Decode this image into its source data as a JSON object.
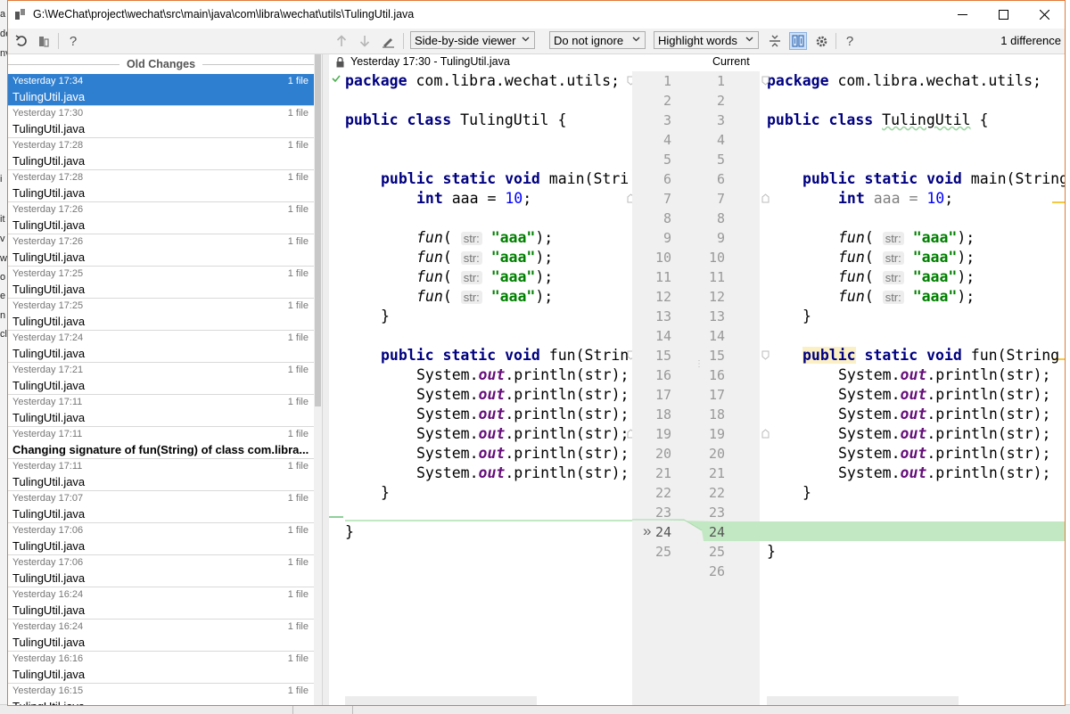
{
  "background_app": {
    "letters": [
      "a",
      "de",
      "nv",
      "i",
      "it",
      "v",
      "w",
      "o",
      "e",
      "n",
      "cl"
    ]
  },
  "window": {
    "title": "G:\\WeChat\\project\\wechat\\src\\main\\java\\com\\libra\\wechat\\utils\\TulingUtil.java",
    "minimize_icon": "minimize-icon",
    "maximize_icon": "maximize-icon",
    "close_icon": "close-icon"
  },
  "toolbar": {
    "viewer_mode": "Side-by-side viewer",
    "whitespace_mode": "Do not ignore",
    "highlight_mode": "Highlight words",
    "difference_count": "1 difference",
    "help_label": "?",
    "icons": [
      "revert-icon",
      "delete-icon",
      "help-icon",
      "prev-diff-icon",
      "next-diff-icon",
      "edit-icon",
      "collapse-icon",
      "sync-scroll-icon",
      "settings-icon",
      "help-icon"
    ]
  },
  "history": {
    "header": "Old Changes",
    "items": [
      {
        "date": "Yesterday 17:34",
        "count": "1 file",
        "name": "TulingUtil.java",
        "selected": true,
        "bold": false
      },
      {
        "date": "Yesterday 17:30",
        "count": "1 file",
        "name": "TulingUtil.java",
        "selected": false,
        "bold": false
      },
      {
        "date": "Yesterday 17:28",
        "count": "1 file",
        "name": "TulingUtil.java",
        "selected": false,
        "bold": false
      },
      {
        "date": "Yesterday 17:28",
        "count": "1 file",
        "name": "TulingUtil.java",
        "selected": false,
        "bold": false
      },
      {
        "date": "Yesterday 17:26",
        "count": "1 file",
        "name": "TulingUtil.java",
        "selected": false,
        "bold": false
      },
      {
        "date": "Yesterday 17:26",
        "count": "1 file",
        "name": "TulingUtil.java",
        "selected": false,
        "bold": false
      },
      {
        "date": "Yesterday 17:25",
        "count": "1 file",
        "name": "TulingUtil.java",
        "selected": false,
        "bold": false
      },
      {
        "date": "Yesterday 17:25",
        "count": "1 file",
        "name": "TulingUtil.java",
        "selected": false,
        "bold": false
      },
      {
        "date": "Yesterday 17:24",
        "count": "1 file",
        "name": "TulingUtil.java",
        "selected": false,
        "bold": false
      },
      {
        "date": "Yesterday 17:21",
        "count": "1 file",
        "name": "TulingUtil.java",
        "selected": false,
        "bold": false
      },
      {
        "date": "Yesterday 17:11",
        "count": "1 file",
        "name": "TulingUtil.java",
        "selected": false,
        "bold": false
      },
      {
        "date": "Yesterday 17:11",
        "count": "1 file",
        "name": "Changing signature of fun(String) of class com.libra...",
        "selected": false,
        "bold": true
      },
      {
        "date": "Yesterday 17:11",
        "count": "1 file",
        "name": "TulingUtil.java",
        "selected": false,
        "bold": false
      },
      {
        "date": "Yesterday 17:07",
        "count": "1 file",
        "name": "TulingUtil.java",
        "selected": false,
        "bold": false
      },
      {
        "date": "Yesterday 17:06",
        "count": "1 file",
        "name": "TulingUtil.java",
        "selected": false,
        "bold": false
      },
      {
        "date": "Yesterday 17:06",
        "count": "1 file",
        "name": "TulingUtil.java",
        "selected": false,
        "bold": false
      },
      {
        "date": "Yesterday 16:24",
        "count": "1 file",
        "name": "TulingUtil.java",
        "selected": false,
        "bold": false
      },
      {
        "date": "Yesterday 16:24",
        "count": "1 file",
        "name": "TulingUtil.java",
        "selected": false,
        "bold": false
      },
      {
        "date": "Yesterday 16:16",
        "count": "1 file",
        "name": "TulingUtil.java",
        "selected": false,
        "bold": false
      },
      {
        "date": "Yesterday 16:15",
        "count": "1 file",
        "name": "TulingUtil.java",
        "selected": false,
        "bold": false
      }
    ]
  },
  "diff": {
    "left_title": "Yesterday 17:30 - TulingUtil.java",
    "right_title": "Current",
    "left_line_numbers": [
      "1",
      "2",
      "3",
      "4",
      "5",
      "6",
      "7",
      "8",
      "9",
      "10",
      "11",
      "12",
      "13",
      "14",
      "15",
      "16",
      "17",
      "18",
      "19",
      "20",
      "21",
      "22",
      "23",
      "24",
      "25"
    ],
    "right_line_numbers": [
      "1",
      "2",
      "3",
      "4",
      "5",
      "6",
      "7",
      "8",
      "9",
      "10",
      "11",
      "12",
      "13",
      "14",
      "15",
      "16",
      "17",
      "18",
      "19",
      "20",
      "21",
      "22",
      "23",
      "24",
      "25",
      "26"
    ],
    "inlay_hint": "str:",
    "changed_marker": "»",
    "status_color_added": "#c2e8c3",
    "tokens": {
      "package": "package",
      "pkg_name": "com.libra.wechat.utils;",
      "public": "public",
      "class": "class",
      "class_name": "TulingUtil",
      "brace_open": "{",
      "brace_close": "}",
      "static": "static",
      "void": "void",
      "main_left": "main(Stri",
      "main_right": "main(String",
      "int": "int",
      "var_decl": "aaa = ",
      "ten": "10",
      "semi": ";",
      "fun": "fun",
      "paren_open": "( ",
      "aaa_str": "\"aaa\"",
      "call_end": ");",
      "fun_left": "fun(Strin",
      "fun_right": "fun(String",
      "system": "System.",
      "out": "out",
      "println_left": ".println(str);",
      "println_right": ".println(str);"
    }
  }
}
